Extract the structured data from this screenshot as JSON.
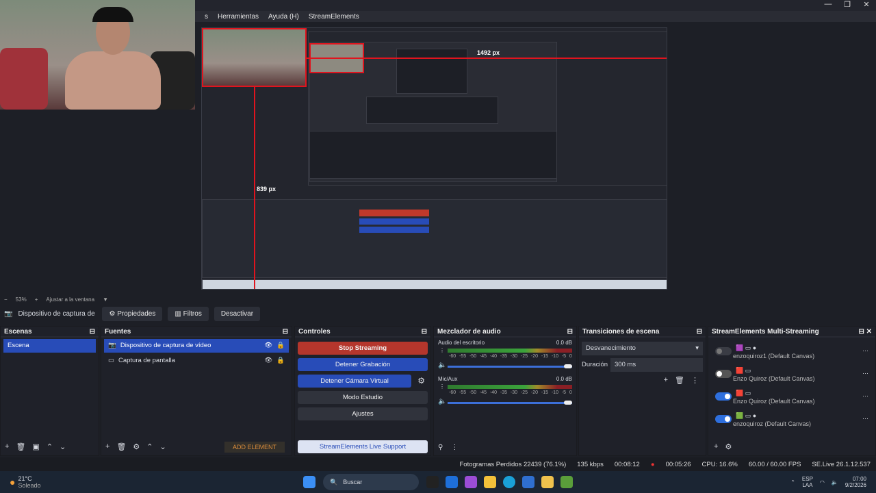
{
  "menubar": {
    "items": [
      "s",
      "Herramientas",
      "Ayuda (H)",
      "StreamElements"
    ]
  },
  "preview": {
    "label_1492": "1492 px",
    "label_839": "839 px"
  },
  "zoombar": {
    "minus": "−",
    "zoom": "53%",
    "plus": "+",
    "fit": "Ajustar a la ventana",
    "arrow": "▼"
  },
  "sourcebar": {
    "source": "Dispositivo de captura de v",
    "props": "Propiedades",
    "filters": "Filtros",
    "deactivate": "Desactivar"
  },
  "scenes": {
    "title": "Escenas",
    "items": [
      "Escena"
    ]
  },
  "sources": {
    "title": "Fuentes",
    "items": [
      "Dispositivo de captura de vídeo",
      "Captura de pantalla"
    ],
    "add_element": "ADD ELEMENT"
  },
  "controls": {
    "title": "Controles",
    "stop_streaming": "Stop Streaming",
    "stop_recording": "Detener Grabación",
    "stop_vcam": "Detener Cámara Virtual",
    "studio_mode": "Modo Estudio",
    "settings": "Ajustes",
    "support": "StreamElements Live Support"
  },
  "mixer": {
    "title": "Mezclador de audio",
    "channels": [
      {
        "name": "Audio del escritorio",
        "db": "0.0 dB"
      },
      {
        "name": "Mic/Aux",
        "db": "0.0 dB"
      }
    ],
    "ticks": [
      "-60",
      "-55",
      "-50",
      "-45",
      "-40",
      "-35",
      "-30",
      "-25",
      "-20",
      "-15",
      "-10",
      "-5",
      "0"
    ]
  },
  "transitions": {
    "title": "Transiciones de escena",
    "selected": "Desvanecimiento",
    "duration_label": "Duración",
    "duration_value": "300 ms"
  },
  "multistream": {
    "title": "StreamElements Multi-Streaming",
    "items": [
      {
        "name": "enzoquiroz1 (Default Canvas)",
        "state": "dis"
      },
      {
        "name": "Enzo Quiroz (Default Canvas)",
        "state": "off"
      },
      {
        "name": "Enzo Quiroz (Default Canvas)",
        "state": "on"
      },
      {
        "name": "enzoquiroz (Default Canvas)",
        "state": "on"
      }
    ]
  },
  "status": {
    "dropped": "Fotogramas Perdidos 22439 (76.1%)",
    "bitrate": "135 kbps",
    "stream_time": "00:08:12",
    "rec_time": "00:05:26",
    "cpu": "CPU: 16.6%",
    "fps": "60.00 / 60.00 FPS",
    "version": "SE.Live 26.1.12.537"
  },
  "taskbar": {
    "temp": "21°C",
    "weather": "Soleado",
    "search": "Buscar",
    "lang1": "ESP",
    "lang2": "LAA",
    "time": "07:00",
    "date": "9/2/2026"
  }
}
